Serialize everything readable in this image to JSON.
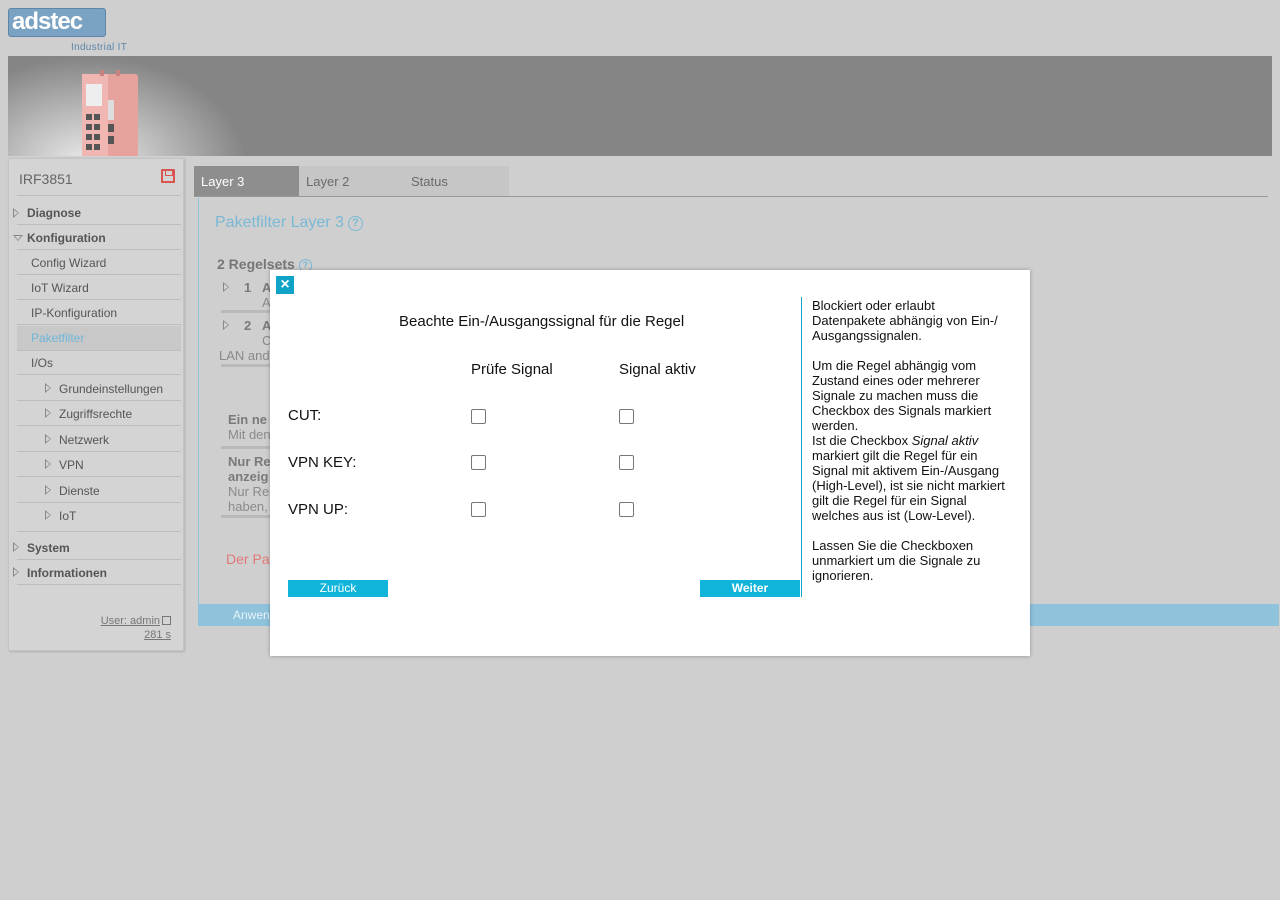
{
  "logo": {
    "brand_part1": "ads",
    "brand_part2": "tec",
    "tagline": "Industrial IT"
  },
  "sidebar": {
    "device_name": "IRF3851",
    "items": [
      {
        "label": "Diagnose"
      },
      {
        "label": "Konfiguration"
      },
      {
        "label": "Config Wizard"
      },
      {
        "label": "IoT Wizard"
      },
      {
        "label": "IP-Konfiguration"
      },
      {
        "label": "Paketfilter"
      },
      {
        "label": "I/Os"
      },
      {
        "label": "Grundeinstellungen"
      },
      {
        "label": "Zugriffsrechte"
      },
      {
        "label": "Netzwerk"
      },
      {
        "label": "VPN"
      },
      {
        "label": "Dienste"
      },
      {
        "label": "IoT"
      },
      {
        "label": "System"
      },
      {
        "label": "Informationen"
      }
    ],
    "user": "User: admin",
    "session": "281 s"
  },
  "tabs": [
    {
      "label": "Layer 3"
    },
    {
      "label": "Layer 2"
    },
    {
      "label": "Status"
    }
  ],
  "main": {
    "title": "Paketfilter Layer 3",
    "help_glyph": "?",
    "ruleset_title": "2 Regelsets",
    "rows": [
      {
        "num": "1",
        "letter": "A",
        "sub": "A"
      },
      {
        "num": "2",
        "letter": "A",
        "sub": "C",
        "extra": "LAN and"
      }
    ],
    "new_rule_title": "Ein ne",
    "new_rule_sub": "Mit den",
    "only_rule_title_1": "Nur Re",
    "only_rule_title_2": "anzeig",
    "only_rule_sub_1": "Nur Re",
    "only_rule_sub_2": "haben,",
    "warning_text": "Der Pa",
    "apply_label": "Anwen"
  },
  "modal": {
    "close_glyph": "×",
    "title": "Beachte Ein-/Ausgangssignal für die Regel",
    "col_check": "Prüfe Signal",
    "col_active": "Signal aktiv",
    "signals": [
      {
        "label": "CUT:",
        "check": false,
        "active": false
      },
      {
        "label": "VPN KEY:",
        "check": false,
        "active": false
      },
      {
        "label": "VPN UP:",
        "check": false,
        "active": false
      }
    ],
    "back_label": "Zurück",
    "next_label": "Weiter",
    "help_p1": "Blockiert oder erlaubt Datenpakete abhängig von Ein-/ Ausgangssignalen.",
    "help_p2": "Um die Regel abhängig vom Zustand eines oder mehrerer Signale zu machen muss die Checkbox des Signals markiert werden.",
    "help_p3_pre": "Ist die Checkbox ",
    "help_p3_em": "Signal aktiv",
    "help_p3_post": " markiert gilt die Regel für ein Signal mit aktivem Ein-/Ausgang (High-Level), ist sie nicht markiert gilt die Regel für ein Signal welches aus ist (Low-Level).",
    "help_p4": "Lassen Sie die Checkboxen unmarkiert um die Signale zu ignorieren."
  }
}
